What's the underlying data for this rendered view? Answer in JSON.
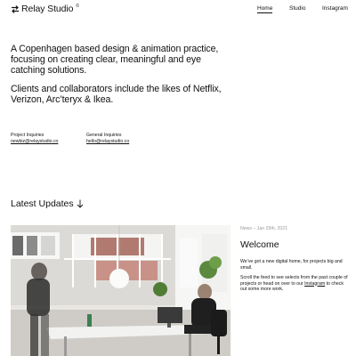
{
  "header": {
    "brand": "Relay Studio",
    "brand_mark": "©",
    "nav": {
      "home": "Home",
      "studio": "Studio",
      "instagram": "Instagram"
    }
  },
  "intro": {
    "line1": "A Copenhagen based design & animation practice, focusing on creating clear, meaningful and eye catching solutions.",
    "line2": "Clients and collaborators include the likes of Netflix, Verizon, Arc’teryx & Ikea."
  },
  "contacts": {
    "projects": {
      "label": "Project Inquiries",
      "email": "newbiz@relaystudio.co"
    },
    "general": {
      "label": "General Inquiries",
      "email": "hello@relaystudio.co"
    }
  },
  "updates": {
    "title": "Latest Updates",
    "icon": "arrow-down-icon"
  },
  "post": {
    "meta": "News – Jan 29th, 2021",
    "title": "Welcome",
    "para1": "We’ve got a new digital home, for projects big and small.",
    "para2_before": "Scroll the feed to see selects from the past couple of projects or head on over to our ",
    "para2_link": "Instagram",
    "para2_after": " to check out some more work."
  },
  "colors": {
    "text": "#111111",
    "muted": "#9a9a9a",
    "background": "#ffffff",
    "accent_wall": "#b07a70"
  }
}
